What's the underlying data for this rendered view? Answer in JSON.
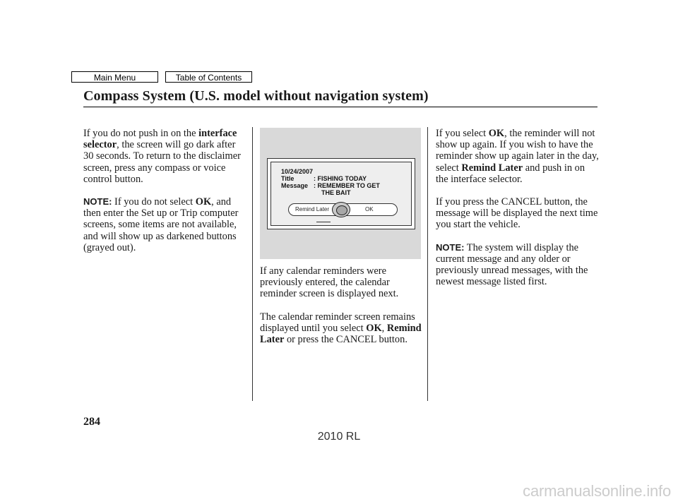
{
  "nav": {
    "main_menu": "Main Menu",
    "table_of_contents": "Table of Contents"
  },
  "section_title": "Compass System (U.S. model without navigation system)",
  "left_column": {
    "p1_text1": "If you do not push in on the ",
    "p1_bold": "interface selector",
    "p1_text2": ", the screen will go dark after 30 seconds. To return to the disclaimer screen, press any compass or voice control button.",
    "note_label": "NOTE:",
    "note_text1": " If you do not select ",
    "note_bold": "OK",
    "note_text2": ", and then enter the Set up or Trip computer screens, some items are not available, and will show up as darkened buttons (grayed out)."
  },
  "screen": {
    "date": "10/24/2007",
    "title_label": "Title",
    "title_value": ": FISHING TODAY",
    "message_label": "Message",
    "message_value_line1": ": REMEMBER TO GET",
    "message_value_line2": "THE BAIT",
    "softkey_left": "Remind Later",
    "softkey_right": "OK"
  },
  "middle_column": {
    "p1": "If any calendar reminders were previously entered, the calendar reminder screen is displayed next.",
    "p2_text1": "The calendar reminder screen remains displayed until you select ",
    "p2_bold1": "OK",
    "p2_sep": ", ",
    "p2_bold2": "Remind Later",
    "p2_text2": " or press the CANCEL button."
  },
  "right_column": {
    "p1_text1": "If you select ",
    "p1_bold1": "OK",
    "p1_text2": ", the reminder will not show up again. If you wish to have the reminder show up again later in the day, select ",
    "p1_bold2": "Remind Later",
    "p1_text3": " and push in on the interface selector.",
    "p2": "If you press the CANCEL button, the message will be displayed the next time you start the vehicle.",
    "note_label": "NOTE:",
    "note_text": " The system will display the current message and any older or previously unread messages, with the newest message listed first."
  },
  "page_number": "284",
  "footer_model": "2010 RL",
  "watermark": "carmanualsonline.info"
}
